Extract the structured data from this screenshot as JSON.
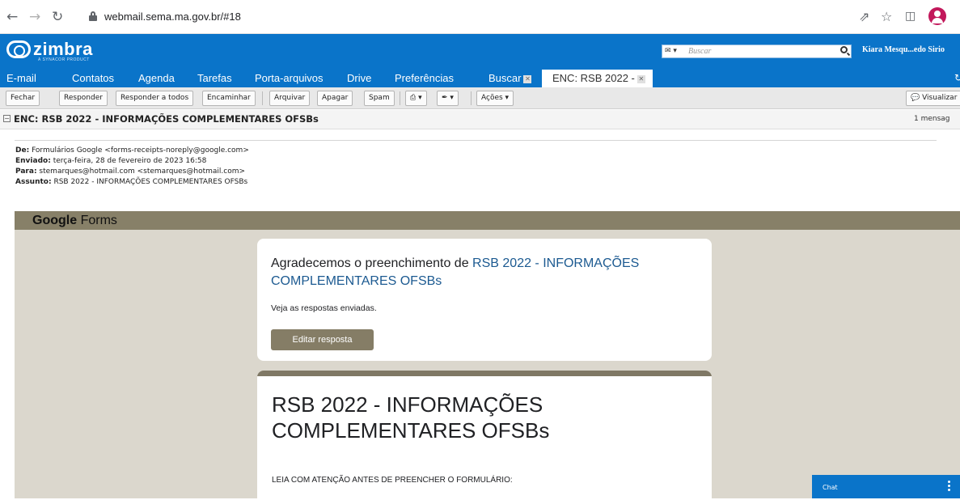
{
  "browser": {
    "url": "webmail.sema.ma.gov.br/#18"
  },
  "zimbra": {
    "logo": "zimbra",
    "logo_sub": "A SYNACOR PRODUCT",
    "search_placeholder": "Buscar",
    "user": "Kiara Mesqu...edo Sirio"
  },
  "apptabs": {
    "email": "E-mail",
    "contacts": "Contatos",
    "calendar": "Agenda",
    "tasks": "Tarefas",
    "briefcase": "Porta-arquivos",
    "drive": "Drive",
    "prefs": "Preferências",
    "search": "Buscar",
    "message_tab": "ENC: RSB 2022 -"
  },
  "toolbar": {
    "close": "Fechar",
    "reply": "Responder",
    "reply_all": "Responder a todos",
    "forward": "Encaminhar",
    "archive": "Arquivar",
    "delete": "Apagar",
    "spam": "Spam",
    "actions": "Ações",
    "view": "Visualizar"
  },
  "message": {
    "subject": "ENC: RSB 2022 - INFORMAÇÕES COMPLEMENTARES OFSBs",
    "count": "1 mensag",
    "from_label": "De:",
    "from": "Formulários Google <forms-receipts-noreply@google.com>",
    "sent_label": "Enviado:",
    "sent": "terça-feira, 28 de fevereiro de 2023 16:58",
    "to_label": "Para:",
    "to": "stemarques@hotmail.com <stemarques@hotmail.com>",
    "subject_label": "Assunto:",
    "subject_value": "RSB 2022 - INFORMAÇÕES COMPLEMENTARES OFSBs"
  },
  "gforms": {
    "logo_google": "Google",
    "logo_forms": "Forms",
    "thanks_prefix": "Agradecemos o preenchimento de",
    "form_link": "RSB 2022 -  INFORMAÇÕES COMPLEMENTARES OFSBs",
    "view_responses": "Veja as respostas enviadas.",
    "edit_button": "Editar resposta",
    "form_title": "RSB 2022 -  INFORMAÇÕES COMPLEMENTARES OFSBs",
    "form_note": "LEIA  COM ATENÇÃO ANTES DE PREENCHER O FORMULÁRIO:"
  },
  "chat": {
    "label": "Chat"
  },
  "colors": {
    "zimbra_blue": "#0a74c9",
    "gforms_band": "#878068",
    "gforms_bg": "#dbd7cd",
    "edit_button": "#857d66"
  }
}
